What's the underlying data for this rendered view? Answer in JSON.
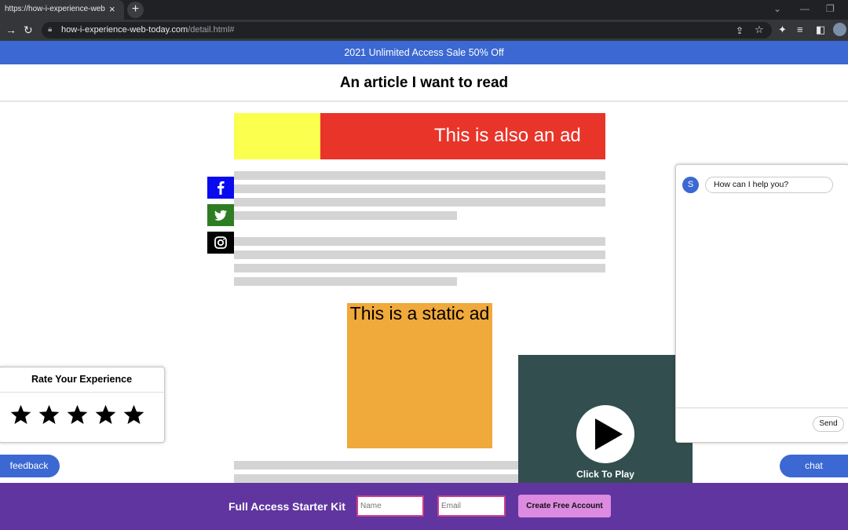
{
  "browser": {
    "tab_title": "https://how-i-experience-web-to",
    "tab_close": "×",
    "new_tab": "+",
    "url_host": "how-i-experience-web-today.com",
    "url_path": "/detail.html#",
    "back_icon": "arrow-right-icon",
    "reload_icon": "reload-icon"
  },
  "banner": {
    "text": "2021 Unlimited Access Sale 50% Off",
    "color": "#3b68d2"
  },
  "header": {
    "title": "An article I want to read"
  },
  "top_ad": {
    "text": "This is also an ad",
    "left_color": "#fbff4d",
    "right_color": "#e9342a"
  },
  "social": [
    {
      "name": "facebook-icon",
      "color": "#0a0af0"
    },
    {
      "name": "twitter-icon",
      "color": "#2f7d22"
    },
    {
      "name": "instagram-icon",
      "color": "#000000"
    }
  ],
  "static_ad": {
    "text": "This is a static ad",
    "color": "#f0a93b"
  },
  "video": {
    "label": "Click To Play",
    "color": "#334e4e"
  },
  "chat_widget": {
    "avatar_initial": "S",
    "message": "How can I help you?",
    "send_label": "Send"
  },
  "rating": {
    "title": "Rate Your Experience",
    "stars": 5
  },
  "feedback_button": {
    "label": "feedback"
  },
  "chat_button": {
    "label": "chat"
  },
  "footer": {
    "title": "Full Access Starter Kit",
    "name_placeholder": "Name",
    "email_placeholder": "Email",
    "submit_label": "Create Free Account",
    "color": "#6035a0"
  }
}
